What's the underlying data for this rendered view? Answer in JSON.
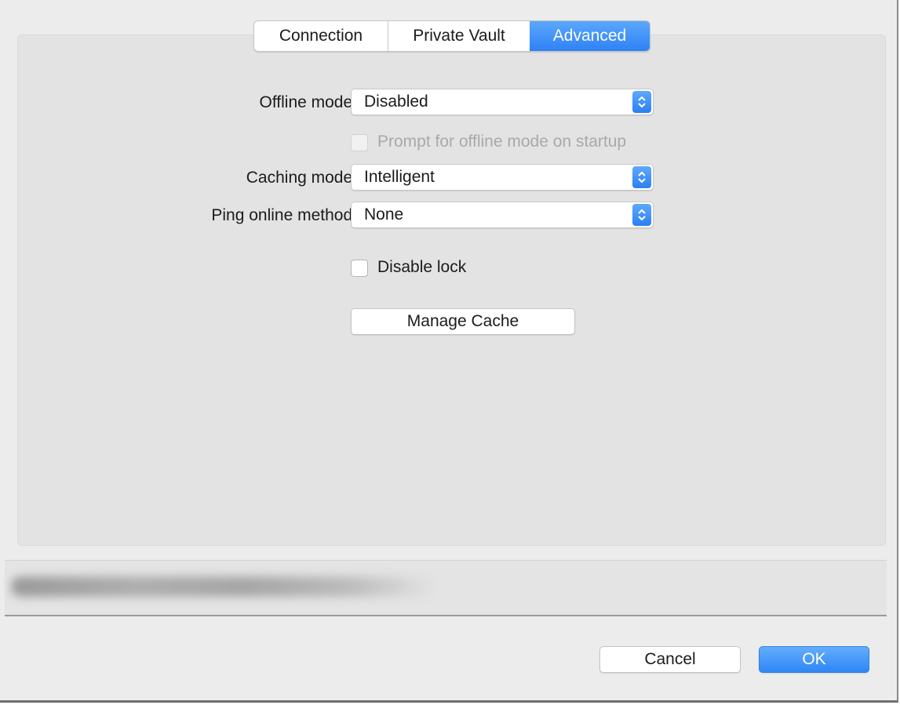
{
  "tabs": [
    {
      "label": "Connection",
      "selected": false
    },
    {
      "label": "Private Vault",
      "selected": false
    },
    {
      "label": "Advanced",
      "selected": true
    }
  ],
  "advanced": {
    "offline_mode": {
      "label": "Offline mode:",
      "value": "Disabled"
    },
    "prompt_offline": {
      "label": "Prompt for offline mode on startup",
      "checked": false,
      "enabled": false
    },
    "caching_mode": {
      "label": "Caching mode:",
      "value": "Intelligent"
    },
    "ping_method": {
      "label": "Ping online method:",
      "value": "None"
    },
    "disable_lock": {
      "label": "Disable lock",
      "checked": false
    },
    "manage_cache_label": "Manage Cache"
  },
  "footer": {
    "cancel_label": "Cancel",
    "ok_label": "OK"
  },
  "colors": {
    "accent": "#2f82f5",
    "window_bg": "#ececec",
    "panel_bg": "#e3e3e3"
  },
  "icons": {
    "popup_arrows": "chevron-up-down-icon"
  }
}
